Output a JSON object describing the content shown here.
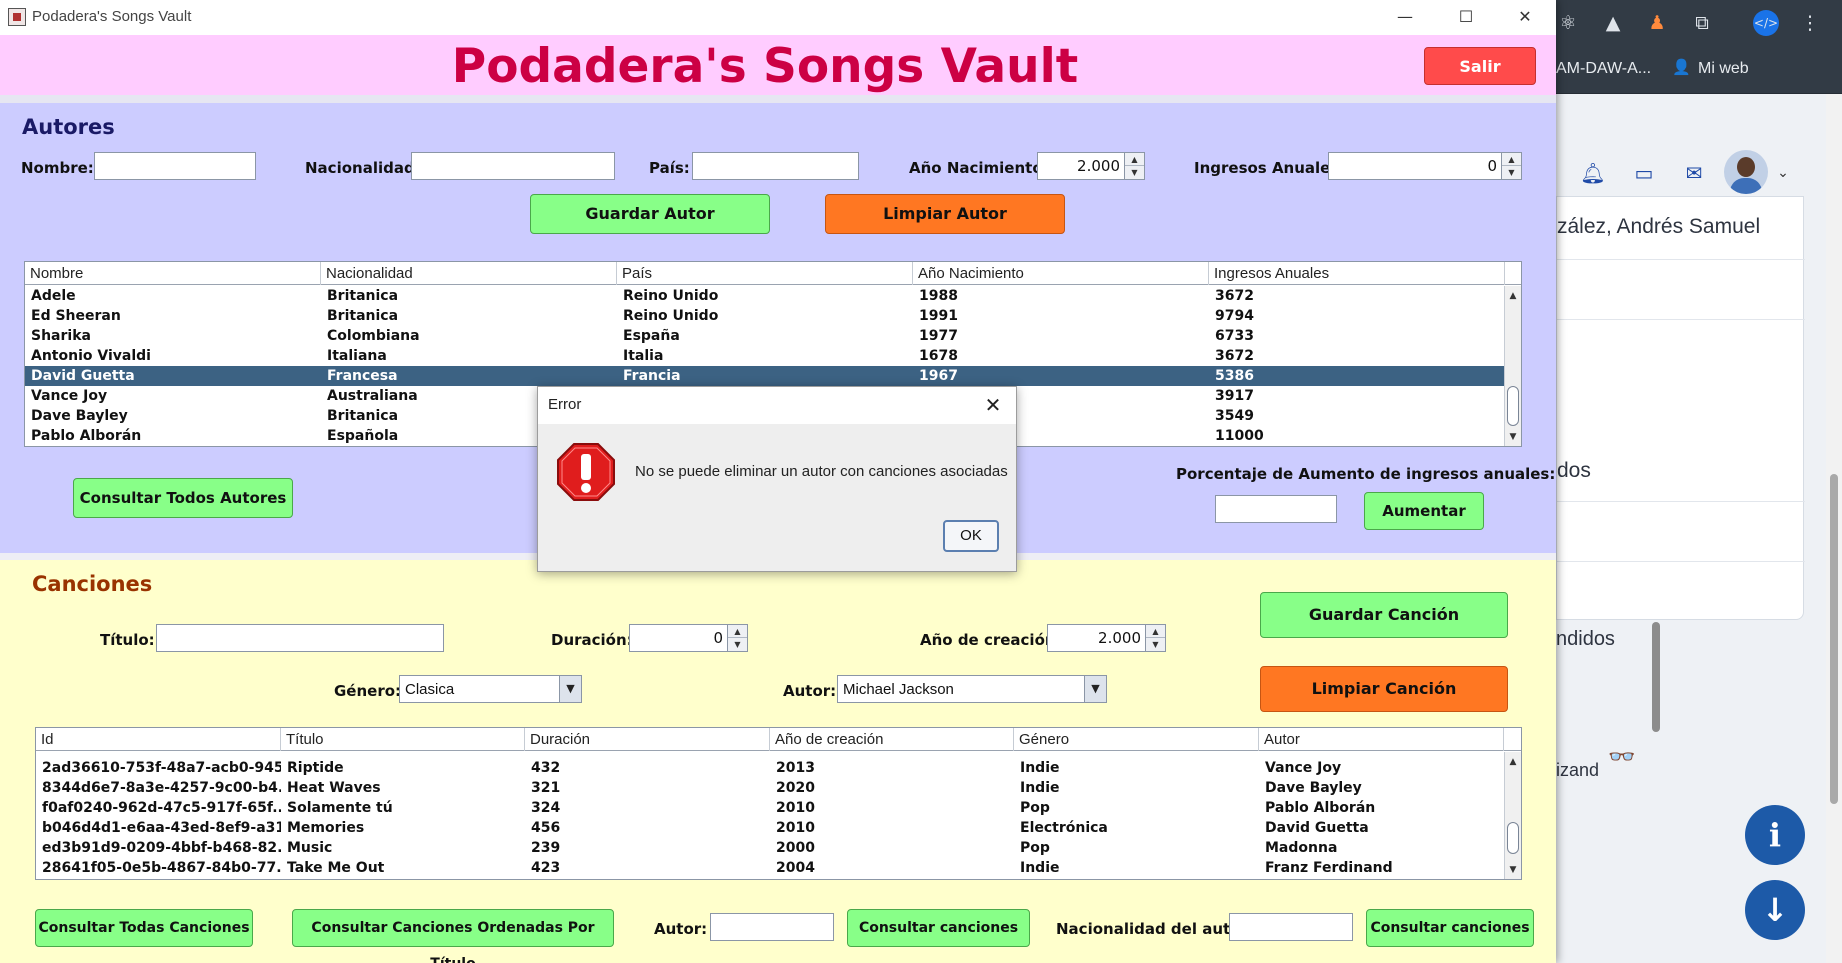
{
  "window": {
    "title": "Podadera's Songs Vault"
  },
  "header": {
    "title": "Podadera's Songs Vault",
    "exit_label": "Salir"
  },
  "autores": {
    "section_title": "Autores",
    "labels": {
      "nombre": "Nombre:",
      "nacionalidad": "Nacionalidad:",
      "pais": "País:",
      "anio": "Año Nacimiento:",
      "ingresos": "Ingresos Anuales:"
    },
    "values": {
      "nombre": "",
      "nacionalidad": "",
      "pais": "",
      "anio": "2.000",
      "ingresos": "0"
    },
    "buttons": {
      "guardar": "Guardar Autor",
      "limpiar": "Limpiar Autor",
      "consultar_todos": "Consultar Todos Autores",
      "aumentar": "Aumentar"
    },
    "porcentaje_label": "Porcentaje de Aumento de ingresos anuales:",
    "porcentaje_value": "",
    "table": {
      "columns": [
        "Nombre",
        "Nacionalidad",
        "País",
        "Año Nacimiento",
        "Ingresos Anuales"
      ],
      "rows": [
        [
          "Adele",
          "Britanica",
          "Reino Unido",
          "1988",
          "3672"
        ],
        [
          "Ed Sheeran",
          "Britanica",
          "Reino Unido",
          "1991",
          "9794"
        ],
        [
          "Sharika",
          "Colombiana",
          "España",
          "1977",
          "6733"
        ],
        [
          "Antonio Vivaldi",
          "Italiana",
          "Italia",
          "1678",
          "3672"
        ],
        [
          "David Guetta",
          "Francesa",
          "Francia",
          "1967",
          "5386"
        ],
        [
          "Vance Joy",
          "Australiana",
          "",
          "",
          "3917"
        ],
        [
          "Dave Bayley",
          "Britanica",
          "",
          "",
          "3549"
        ],
        [
          "Pablo Alborán",
          "Española",
          "",
          "",
          "11000"
        ]
      ],
      "selected_index": 4
    }
  },
  "canciones": {
    "section_title": "Canciones",
    "labels": {
      "titulo": "Título:",
      "duracion": "Duración:",
      "anio": "Año de creación:",
      "genero": "Género:",
      "autor": "Autor:"
    },
    "values": {
      "titulo": "",
      "duracion": "0",
      "anio": "2.000",
      "genero": "Clasica",
      "autor": "Michael Jackson"
    },
    "buttons": {
      "guardar": "Guardar Canción",
      "limpiar": "Limpiar Canción",
      "consultar_todas": "Consultar Todas Canciones",
      "consultar_ordenadas": "Consultar Canciones Ordenadas Por Título",
      "consultar_autor": "Consultar canciones",
      "consultar_nacionalidad": "Consultar canciones"
    },
    "filter_labels": {
      "autor": "Autor:",
      "nacionalidad": "Nacionalidad del autor:"
    },
    "filter_values": {
      "autor": "",
      "nacionalidad": ""
    },
    "table": {
      "columns": [
        "Id",
        "Título",
        "Duración",
        "Año de creación",
        "Género",
        "Autor"
      ],
      "rows": [
        [
          "2ad36610-753f-48a7-acb0-945...",
          "Riptide",
          "432",
          "2013",
          "Indie",
          "Vance Joy"
        ],
        [
          "8344d6e7-8a3e-4257-9c00-b4...",
          "Heat Waves",
          "321",
          "2020",
          "Indie",
          "Dave Bayley"
        ],
        [
          "f0af0240-962d-47c5-917f-65f...",
          "Solamente tú",
          "324",
          "2010",
          "Pop",
          "Pablo Alborán"
        ],
        [
          "b046d4d1-e6aa-43ed-8ef9-a31...",
          "Memories",
          "456",
          "2010",
          "Electrónica",
          "David Guetta"
        ],
        [
          "ed3b91d9-0209-4bbf-b468-82...",
          "Music",
          "239",
          "2000",
          "Pop",
          "Madonna"
        ],
        [
          "28641f05-0e5b-4867-84b0-77...",
          "Take Me Out",
          "423",
          "2004",
          "Indie",
          "Franz Ferdinand"
        ]
      ]
    }
  },
  "dialog": {
    "title": "Error",
    "message": "No se puede eliminar un autor con canciones asociadas",
    "ok_label": "OK"
  },
  "browser": {
    "bookmark_1": "AM-DAW-A...",
    "bookmark_2": "Mi web",
    "user_name": "zález, Andrés Samuel",
    "fragment_1": "dos",
    "fragment_2": "ndidos",
    "fragment_3": "izand"
  },
  "colors": {
    "header_bg": "#ffccff",
    "header_title": "#cc0044",
    "autores_bg": "#ccccff",
    "canciones_bg": "#ffffcc",
    "button_green": "#88ff88",
    "button_orange": "#ff7722",
    "button_red": "#ff4b4b",
    "selection": "#3c6283"
  }
}
